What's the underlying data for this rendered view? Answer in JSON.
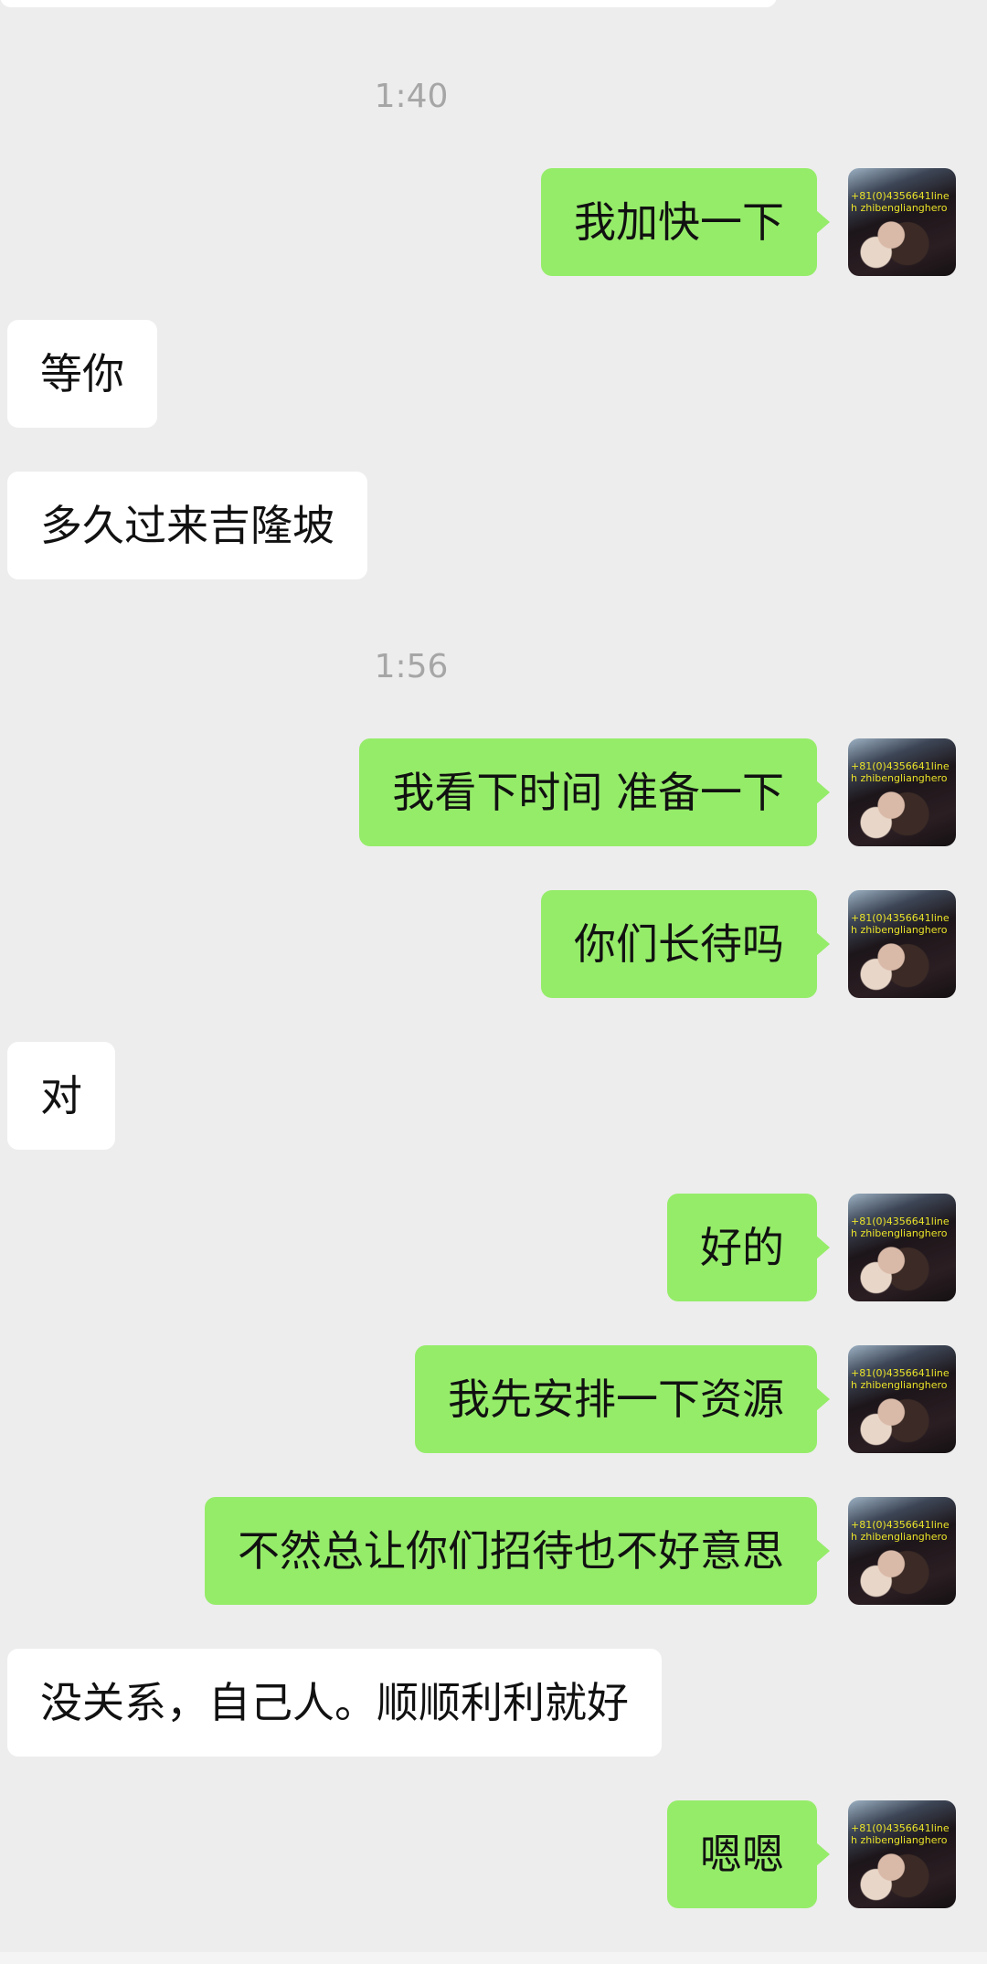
{
  "conversation": {
    "avatar_watermark": "+81(0)4356641lineh zhibenglianghero",
    "timestamps": [
      "1:40",
      "1:56"
    ],
    "messages": [
      {
        "side": "sent",
        "text": "我加快一下"
      },
      {
        "side": "received",
        "text": "等你"
      },
      {
        "side": "received",
        "text": "多久过来吉隆坡"
      },
      {
        "side": "sent",
        "text": "我看下时间 准备一下"
      },
      {
        "side": "sent",
        "text": "你们长待吗"
      },
      {
        "side": "received",
        "text": "对"
      },
      {
        "side": "sent",
        "text": "好的"
      },
      {
        "side": "sent",
        "text": "我先安排一下资源"
      },
      {
        "side": "sent",
        "text": "不然总让你们招待也不好意思"
      },
      {
        "side": "received",
        "text": "没关系，自己人。顺顺利利就好"
      },
      {
        "side": "sent",
        "text": "嗯嗯"
      }
    ]
  },
  "colors": {
    "background": "#ededed",
    "sent_bubble": "#95ec69",
    "received_bubble": "#ffffff",
    "timestamp_text": "#a6a6a6",
    "message_text": "#111111"
  }
}
